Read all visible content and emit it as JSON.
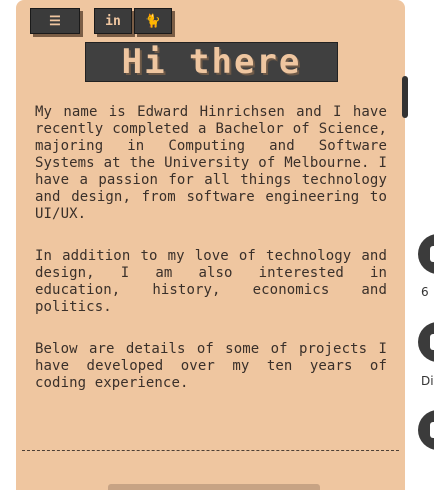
{
  "toolbar": {
    "menu_icon": "☰",
    "social": [
      {
        "icon": "in"
      },
      {
        "icon": "🐈"
      }
    ]
  },
  "title": "Hi there",
  "paragraphs": [
    "My name is Edward Hinrichsen and I have recently completed a Bachelor of Science, majoring in Computing and Software Systems at the University of Melbourne. I have a passion for all things technology and design, from software engineering to UI/UX.",
    "In addition to my love of technology and design, I am also interested in education, history, economics and politics.",
    "Below are details of some of projects I have developed over my ten years of coding experience."
  ],
  "side_panel": {
    "items": [
      {
        "label": "6"
      },
      {
        "label": "Di"
      },
      {
        "label": ""
      }
    ]
  },
  "colors": {
    "background": "#efc6a0",
    "accent_dark": "#3b3b3b"
  }
}
